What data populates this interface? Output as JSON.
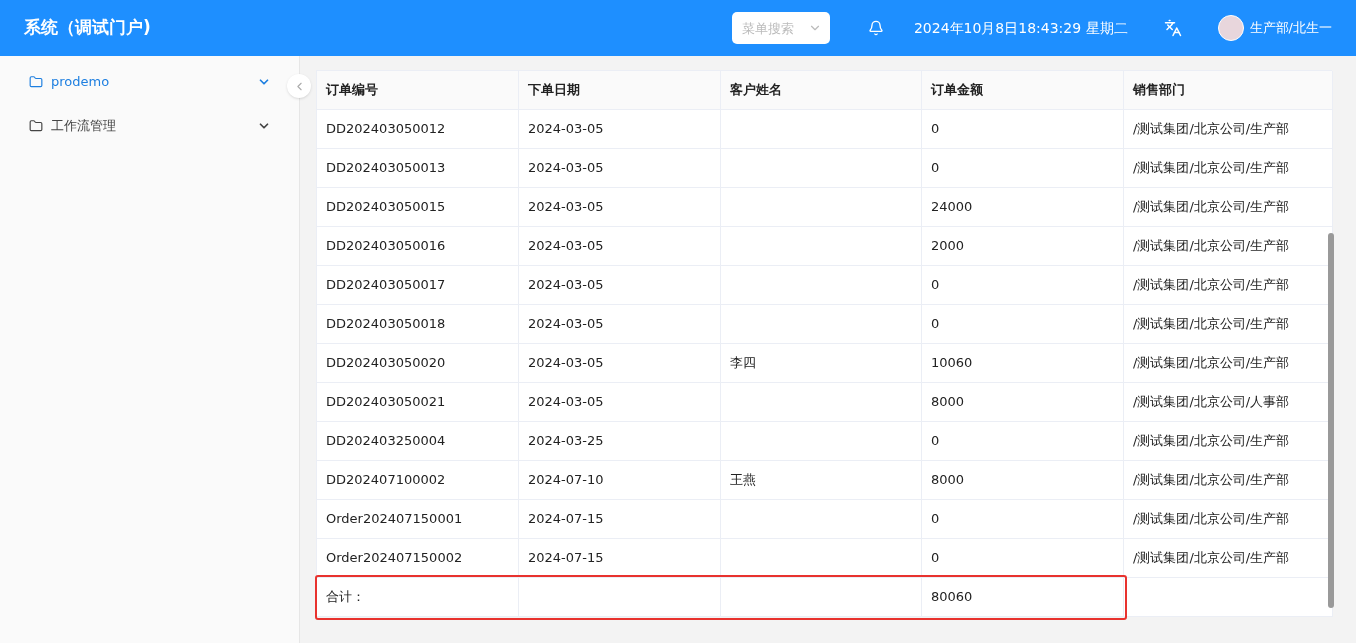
{
  "header": {
    "title": "系统（调试门户)",
    "search": {
      "placeholder": "菜单搜索"
    },
    "datetime": "2024年10月8日18:43:29 星期二",
    "user": "生产部/北生一"
  },
  "sidebar": {
    "items": [
      {
        "label": "prodemo",
        "selected": true
      },
      {
        "label": "工作流管理",
        "selected": false
      }
    ]
  },
  "table": {
    "columns": [
      "订单编号",
      "下单日期",
      "客户姓名",
      "订单金额",
      "销售部门"
    ],
    "rows": [
      {
        "order_no": "DD202403050012",
        "date": "2024-03-05",
        "amount": "0",
        "dept": "/测试集团/北京公司/生产部"
      },
      {
        "order_no": "DD202403050013",
        "date": "2024-03-05",
        "amount": "0",
        "dept": "/测试集团/北京公司/生产部"
      },
      {
        "order_no": "DD202403050015",
        "date": "2024-03-05",
        "amount": "24000",
        "dept": "/测试集团/北京公司/生产部"
      },
      {
        "order_no": "DD202403050016",
        "date": "2024-03-05",
        "amount": "2000",
        "dept": "/测试集团/北京公司/生产部"
      },
      {
        "order_no": "DD202403050017",
        "date": "2024-03-05",
        "amount": "0",
        "dept": "/测试集团/北京公司/生产部"
      },
      {
        "order_no": "DD202403050018",
        "date": "2024-03-05",
        "amount": "0",
        "dept": "/测试集团/北京公司/生产部"
      },
      {
        "order_no": "DD202403050020",
        "date": "2024-03-05",
        "customer": "李四",
        "amount": "10060",
        "dept": "/测试集团/北京公司/生产部"
      },
      {
        "order_no": "DD202403050021",
        "date": "2024-03-05",
        "amount": "8000",
        "dept": "/测试集团/北京公司/人事部"
      },
      {
        "order_no": "DD202403250004",
        "date": "2024-03-25",
        "amount": "0",
        "dept": "/测试集团/北京公司/生产部"
      },
      {
        "order_no": "DD202407100002",
        "date": "2024-07-10",
        "customer": "王燕",
        "amount": "8000",
        "dept": "/测试集团/北京公司/生产部"
      },
      {
        "order_no": "Order202407150001",
        "date": "2024-07-15",
        "amount": "0",
        "dept": "/测试集团/北京公司/生产部"
      },
      {
        "order_no": "Order202407150002",
        "date": "2024-07-15",
        "amount": "0",
        "dept": "/测试集团/北京公司/生产部"
      }
    ],
    "total": {
      "label": "合计：",
      "amount": "80060"
    }
  }
}
